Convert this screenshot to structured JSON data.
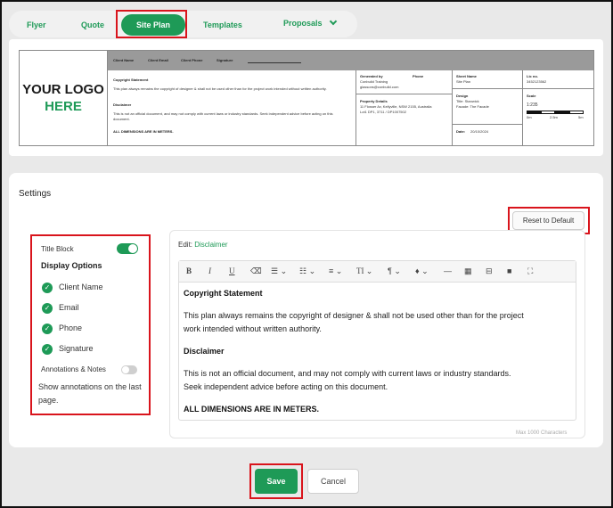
{
  "tabs": {
    "flyer": "Flyer",
    "quote": "Quote",
    "site_plan": "Site Plan",
    "templates": "Templates",
    "proposals": "Proposals"
  },
  "title_block": {
    "logo_line1": "YOUR LOGO",
    "logo_line2": "HERE",
    "header": {
      "client_name": "Client Name",
      "client_email": "Client Email",
      "client_phone": "Client Phone",
      "signature": "Signature"
    },
    "copyright_title": "Copyright Statement",
    "copyright_text": "This plan always remains the copyright of designer & shall not be used other than for the project work intended without written authority.",
    "disclaimer_title": "Disclaimer",
    "disclaimer_text": "This is not an official document, and may not comply with current laws or industry standards. Seek independent advice before acting on this document.",
    "dimensions": "ALL DIMENSIONS ARE IN METERS.",
    "generated_by_label": "Generated by",
    "generated_by_1": "Conbuild Training",
    "generated_by_2": "glassons@conbuild.com",
    "phone_label": "Phone",
    "property_label": "Property Details",
    "property_1": "11 Flosser Av, Kellyville, NSW 2155, Australia",
    "property_2": "Lot1 DP1, 3711 / DP1007502",
    "sheet_label": "Sheet Name",
    "sheet_value": "Site Plan",
    "lic_label": "Lic no.",
    "lic_value": "3452123562",
    "design_label": "Design",
    "design_title": "Title: Stanwick",
    "design_facade": "Facade: The Facade",
    "scale_label": "Scale",
    "scale_value": "1:235",
    "scale_0": "0m",
    "scale_1": "2.5m",
    "scale_2": "5m",
    "date_label": "Date:",
    "date_value": "20/10/2024"
  },
  "settings": {
    "title": "Settings",
    "reset_label": "Reset to Default",
    "title_block_label": "Title Block",
    "display_options": "Display Options",
    "options": [
      "Client Name",
      "Email",
      "Phone",
      "Signature"
    ],
    "annotations_label": "Annotations & Notes",
    "annotations_note": "Show annotations on the last page."
  },
  "editor": {
    "edit_prefix": "Edit:",
    "edit_target": "Disclaimer",
    "copyright_heading": "Copyright Statement",
    "copyright_text_1": "This plan always remains the copyright of designer & shall not be used other than for the project",
    "copyright_text_2": "work intended without written authority.",
    "disclaimer_heading": "Disclaimer",
    "disclaimer_text_1": "This is not an official document, and may not comply with current laws or industry standards.",
    "disclaimer_text_2": "Seek independent advice before acting on this document.",
    "dimensions": "ALL DIMENSIONS ARE IN METERS.",
    "max_chars": "Max 1000 Characters"
  },
  "footer": {
    "save": "Save",
    "cancel": "Cancel"
  },
  "colors": {
    "accent": "#1e9a57",
    "highlight": "#d9141c"
  }
}
